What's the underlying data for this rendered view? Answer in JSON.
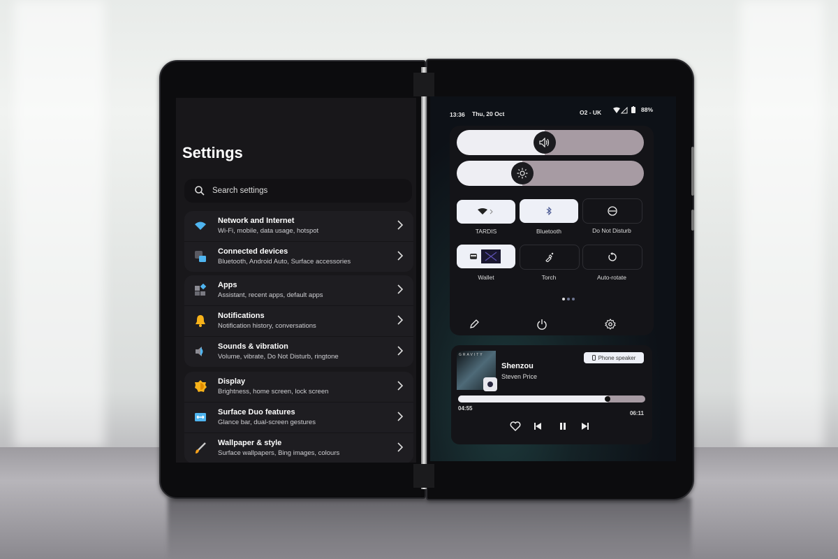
{
  "settings": {
    "title": "Settings",
    "search_placeholder": "Search settings",
    "groups": [
      [
        {
          "title": "Network and Internet",
          "subtitle": "Wi-Fi, mobile, data usage, hotspot",
          "icon": "wifi-icon"
        },
        {
          "title": "Connected devices",
          "subtitle": "Bluetooth, Android Auto, Surface accessories",
          "icon": "devices-icon"
        }
      ],
      [
        {
          "title": "Apps",
          "subtitle": "Assistant, recent apps, default apps",
          "icon": "apps-icon"
        },
        {
          "title": "Notifications",
          "subtitle": "Notification history, conversations",
          "icon": "bell-icon"
        },
        {
          "title": "Sounds & vibration",
          "subtitle": "Volume, vibrate, Do Not Disturb, ringtone",
          "icon": "speaker-icon"
        }
      ],
      [
        {
          "title": "Display",
          "subtitle": "Brightness, home screen, lock screen",
          "icon": "brightness-icon"
        },
        {
          "title": "Surface Duo features",
          "subtitle": "Glance bar, dual-screen gestures",
          "icon": "dual-screen-icon"
        },
        {
          "title": "Wallpaper & style",
          "subtitle": "Surface wallpapers, Bing images, colours",
          "icon": "brush-icon"
        }
      ]
    ]
  },
  "status_bar": {
    "time": "13:36",
    "date": "Thu, 20 Oct",
    "carrier": "O2 - UK",
    "battery": "88%"
  },
  "quick_settings": {
    "volume_level": 0.47,
    "brightness_level": 0.35,
    "tiles": [
      {
        "label": "TARDIS",
        "icon": "wifi-icon",
        "active": true
      },
      {
        "label": "Bluetooth",
        "icon": "bluetooth-icon",
        "active": true
      },
      {
        "label": "Do Not Disturb",
        "icon": "dnd-icon",
        "active": false
      },
      {
        "label": "Wallet",
        "icon": "wallet-icon",
        "active": true
      },
      {
        "label": "Torch",
        "icon": "torch-icon",
        "active": false
      },
      {
        "label": "Auto-rotate",
        "icon": "rotate-icon",
        "active": false
      }
    ],
    "page_index": 1,
    "page_count": 3
  },
  "media": {
    "album_text": "GRAVITY",
    "song": "Shenzou",
    "artist": "Steven Price",
    "output_label": "Phone speaker",
    "elapsed": "04:55",
    "duration": "06:11",
    "progress": 0.8
  }
}
